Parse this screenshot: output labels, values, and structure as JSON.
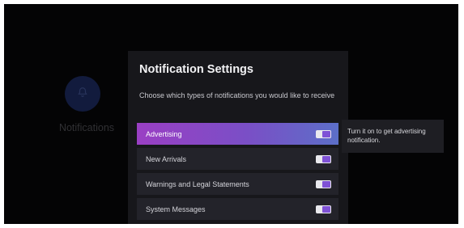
{
  "background": {
    "icon": "bell-icon",
    "label": "Notifications"
  },
  "dialog": {
    "title": "Notification Settings",
    "description": "Choose which types of notifications you would like to receive",
    "items": [
      {
        "label": "Advertising",
        "enabled": true,
        "selected": true
      },
      {
        "label": "New Arrivals",
        "enabled": true,
        "selected": false
      },
      {
        "label": "Warnings and Legal Statements",
        "enabled": true,
        "selected": false
      },
      {
        "label": "System Messages",
        "enabled": true,
        "selected": false
      }
    ]
  },
  "tooltip": {
    "text": "Turn it on to get advertising notification."
  },
  "colors": {
    "accent": "#8a48c8",
    "toggle_on": "#7f52d6"
  }
}
